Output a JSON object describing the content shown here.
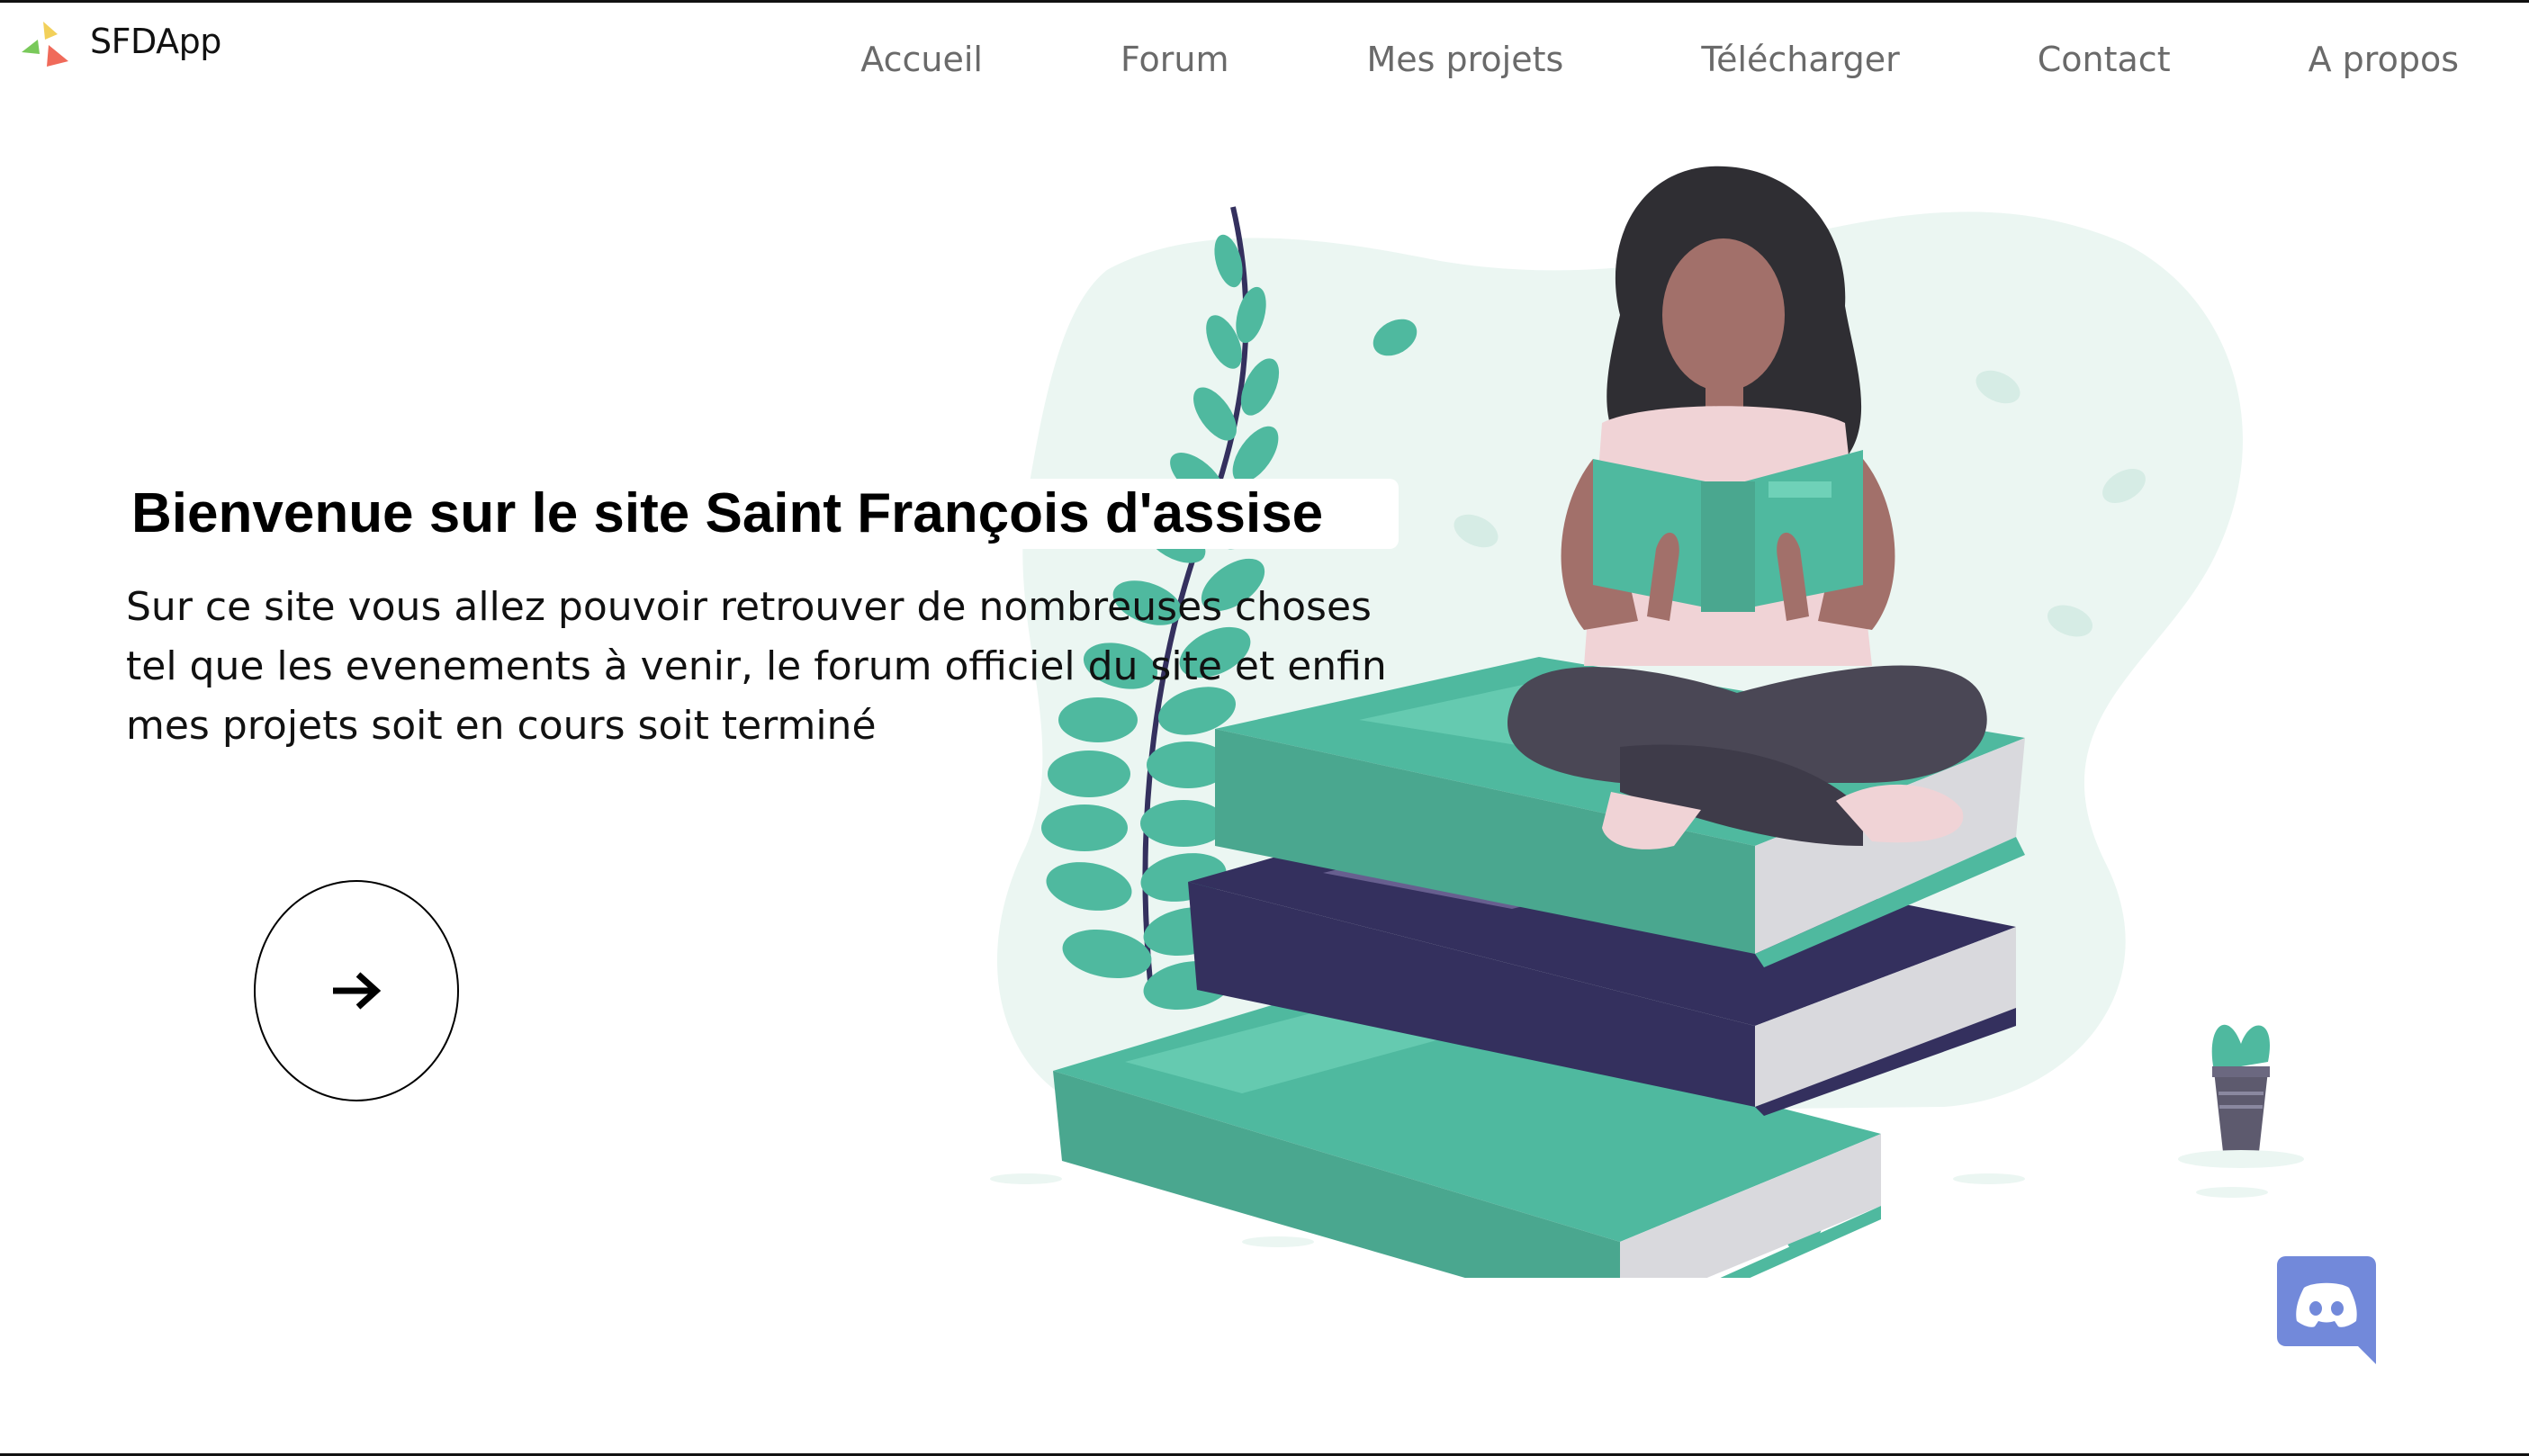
{
  "header": {
    "brand": "SFDApp",
    "nav": [
      "Accueil",
      "Forum",
      "Mes projets",
      "Télécharger",
      "Contact",
      "A propos"
    ]
  },
  "hero": {
    "title": "Bienvenue sur le site Saint François d'assise",
    "text": "Sur ce site vous allez pouvoir retrouver de nombreuses choses tel que les evenements à venir, le forum officiel du site et enfin mes projets soit en cours soit terminé",
    "button_icon": "arrow-right-icon"
  },
  "illustration": {
    "subject": "woman-reading-on-books",
    "colors": {
      "teal": "#4fb99f",
      "navy": "#34305e",
      "skin": "#a2706a",
      "hair": "#2f2e33",
      "backdrop": "#ebf6f2"
    }
  },
  "floating": {
    "icon": "discord-icon",
    "color": "#7289da"
  },
  "colors": {
    "nav_text": "#6a6a6a",
    "text": "#111111",
    "background": "#ffffff"
  }
}
